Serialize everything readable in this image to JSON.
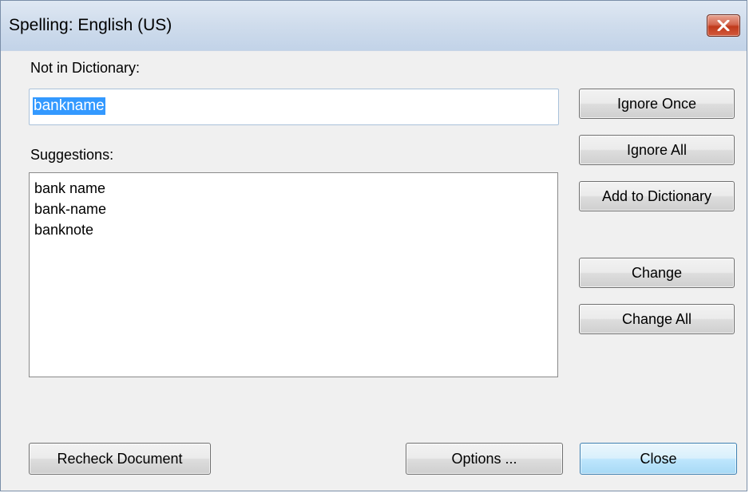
{
  "window": {
    "title": "Spelling: English (US)"
  },
  "not_in_dictionary": {
    "label": "Not in Dictionary:",
    "value": "bankname"
  },
  "suggestions": {
    "label": "Suggestions:",
    "items": [
      "bank name",
      "bank-name",
      "banknote"
    ]
  },
  "buttons": {
    "ignore_once": "Ignore Once",
    "ignore_all": "Ignore All",
    "add_to_dictionary": "Add to Dictionary",
    "change": "Change",
    "change_all": "Change All",
    "recheck_document": "Recheck Document",
    "options": "Options ...",
    "close": "Close"
  },
  "colors": {
    "selection": "#3399ff",
    "close_button": "#c8432a",
    "default_button": "#bee6fd"
  }
}
